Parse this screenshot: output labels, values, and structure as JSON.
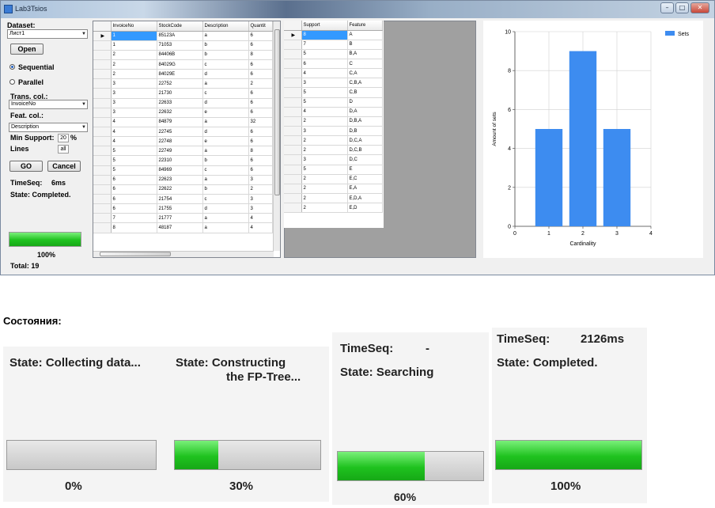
{
  "window": {
    "title": "Lab3Tsios",
    "min": "–",
    "max": "□",
    "close": "✕"
  },
  "left": {
    "dataset_label": "Dataset:",
    "dataset_value": "Лист1",
    "open_button": "Open",
    "sequential_label": "Sequential",
    "parallel_label": "Parallel",
    "trans_col_label": "Trans. col.:",
    "trans_col_value": "InvoiceNo",
    "feat_col_label": "Feat. col.:",
    "feat_col_value": "Description",
    "min_support_label": "Min Support:",
    "min_support_value": "20",
    "min_support_unit": "%",
    "lines_label": "Lines",
    "lines_value": "all",
    "go_button": "GO",
    "cancel_button": "Cancel",
    "timeseq_label": "TimeSeq:",
    "timeseq_value": "6ms",
    "state_text": "State:  Completed.",
    "progress_percent": 100,
    "progress_label": "100%",
    "total_text": "Total:  19"
  },
  "data_grid": {
    "columns": [
      "InvoiceNo",
      "StockCode",
      "Description",
      "Quantit"
    ],
    "rows": [
      [
        "1",
        "85123A",
        "a",
        "6"
      ],
      [
        "1",
        "71053",
        "b",
        "6"
      ],
      [
        "2",
        "84406B",
        "b",
        "8"
      ],
      [
        "2",
        "84029G",
        "c",
        "6"
      ],
      [
        "2",
        "84029E",
        "d",
        "6"
      ],
      [
        "3",
        "22752",
        "a",
        "2"
      ],
      [
        "3",
        "21730",
        "c",
        "6"
      ],
      [
        "3",
        "22633",
        "d",
        "6"
      ],
      [
        "3",
        "22632",
        "e",
        "6"
      ],
      [
        "4",
        "84879",
        "a",
        "32"
      ],
      [
        "4",
        "22745",
        "d",
        "6"
      ],
      [
        "4",
        "22748",
        "e",
        "6"
      ],
      [
        "5",
        "22749",
        "a",
        "8"
      ],
      [
        "5",
        "22310",
        "b",
        "6"
      ],
      [
        "5",
        "84969",
        "c",
        "6"
      ],
      [
        "6",
        "22623",
        "a",
        "3"
      ],
      [
        "6",
        "22622",
        "b",
        "2"
      ],
      [
        "6",
        "21754",
        "c",
        "3"
      ],
      [
        "6",
        "21755",
        "d",
        "3"
      ],
      [
        "7",
        "21777",
        "a",
        "4"
      ],
      [
        "8",
        "48187",
        "a",
        "4"
      ]
    ]
  },
  "result_grid": {
    "columns": [
      "Support",
      "Feature"
    ],
    "rows": [
      [
        "8",
        "A"
      ],
      [
        "7",
        "B"
      ],
      [
        "5",
        "B,A"
      ],
      [
        "6",
        "C"
      ],
      [
        "4",
        "C,A"
      ],
      [
        "3",
        "C,B,A"
      ],
      [
        "5",
        "C,B"
      ],
      [
        "5",
        "D"
      ],
      [
        "4",
        "D,A"
      ],
      [
        "2",
        "D,B,A"
      ],
      [
        "3",
        "D,B"
      ],
      [
        "2",
        "D,C,A"
      ],
      [
        "2",
        "D,C,B"
      ],
      [
        "3",
        "D,C"
      ],
      [
        "5",
        "E"
      ],
      [
        "2",
        "E,C"
      ],
      [
        "2",
        "E,A"
      ],
      [
        "2",
        "E,D,A"
      ],
      [
        "2",
        "E,D"
      ]
    ]
  },
  "chart_data": {
    "type": "bar",
    "x": [
      1,
      2,
      3
    ],
    "values": [
      5,
      9,
      5
    ],
    "series": [
      {
        "name": "Sets",
        "values": [
          5,
          9,
          5
        ]
      }
    ],
    "xlabel": "Cardinality",
    "ylabel": "Amount of sets",
    "xlim": [
      0,
      4
    ],
    "ylim": [
      0,
      10
    ],
    "xticks": [
      "0",
      "1",
      "2",
      "3",
      "4"
    ],
    "yticks": [
      "0",
      "2",
      "4",
      "6",
      "8",
      "10"
    ],
    "legend_position": "top-right",
    "bar_color": "#3d8cf0",
    "grid": true
  },
  "states": {
    "heading": "Состояния:",
    "panels": [
      {
        "line1": "State:  Collecting data...",
        "line2": "",
        "percent": 0,
        "percent_label": "0%"
      },
      {
        "line1": "State:  Constructing",
        "line2": "the FP-Tree...",
        "percent": 30,
        "percent_label": "30%"
      },
      {
        "timeseq_label": "TimeSeq:",
        "timeseq_value": "-",
        "line1": "State:  Searching",
        "percent": 60,
        "percent_label": "60%"
      },
      {
        "timeseq_label": "TimeSeq:",
        "timeseq_value": "2126ms",
        "line1": "State:  Completed.",
        "percent": 100,
        "percent_label": "100%"
      }
    ]
  },
  "colors": {
    "accent": "#3399ff",
    "progress_green": "#1fc21f",
    "gray_area": "#a0a0a0"
  }
}
